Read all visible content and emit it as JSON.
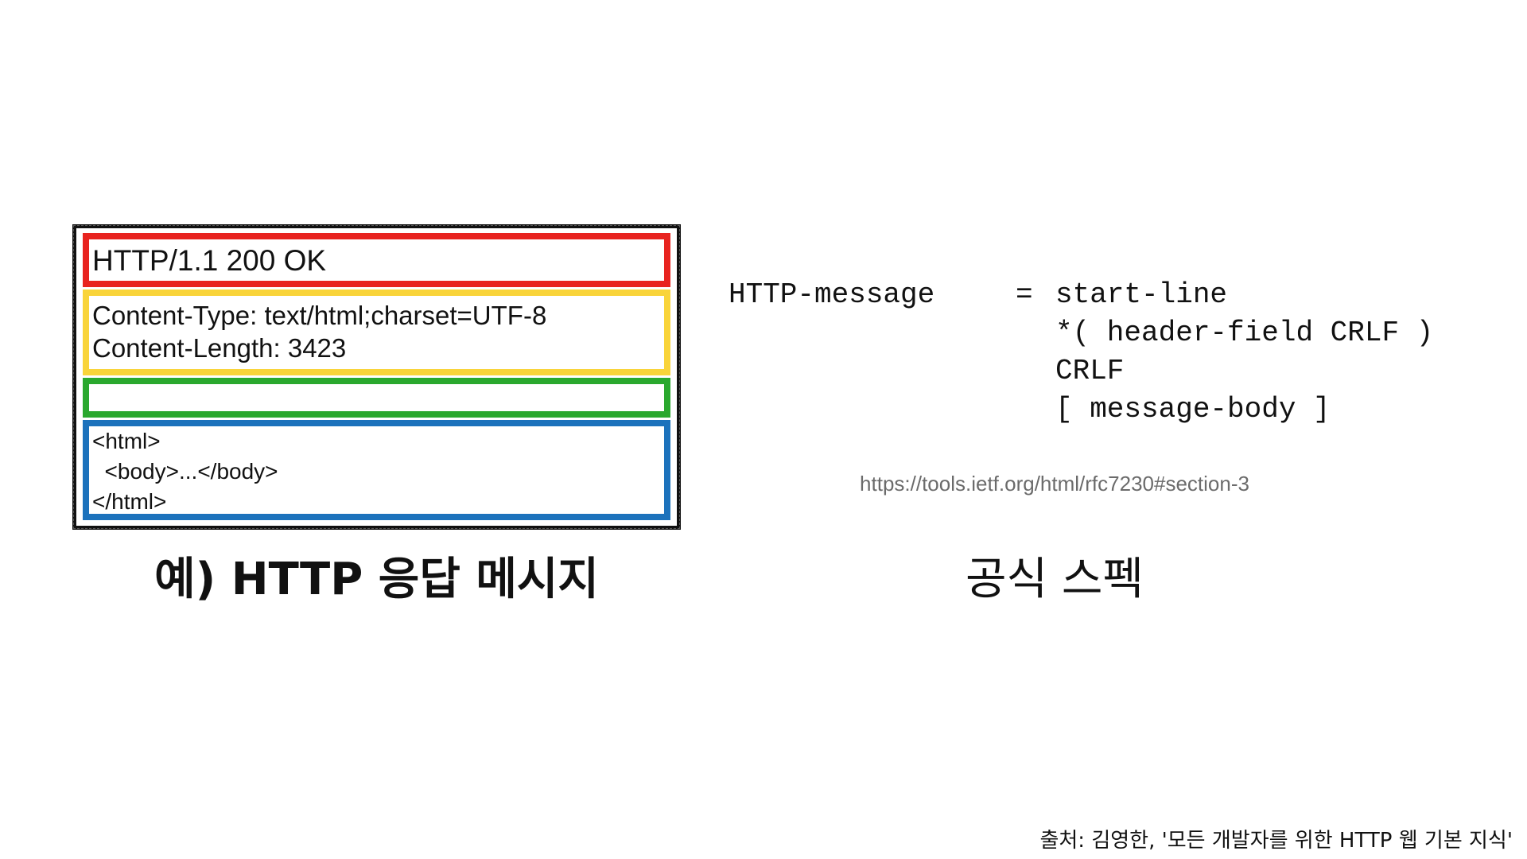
{
  "example": {
    "start_line": "HTTP/1.1 200 OK",
    "headers": [
      "Content-Type: text/html;charset=UTF-8",
      "Content-Length: 3423"
    ],
    "body_lines": [
      "<html>",
      "  <body>...</body>",
      "</html>"
    ],
    "caption": "예) HTTP 응답 메시지",
    "colors": {
      "frame": "#111111",
      "start_line": "#e8231f",
      "headers": "#f9d43a",
      "empty_line": "#2aa82e",
      "body": "#1c72bc"
    }
  },
  "spec": {
    "name": "HTTP-message",
    "equals": "=",
    "rules": [
      "start-line",
      "*( header-field CRLF )",
      "CRLF",
      "[ message-body ]"
    ],
    "url": "https://tools.ietf.org/html/rfc7230#section-3",
    "caption": "공식 스펙"
  },
  "source": "출처: 김영한, '모든 개발자를 위한 HTTP 웹 기본 지식'"
}
